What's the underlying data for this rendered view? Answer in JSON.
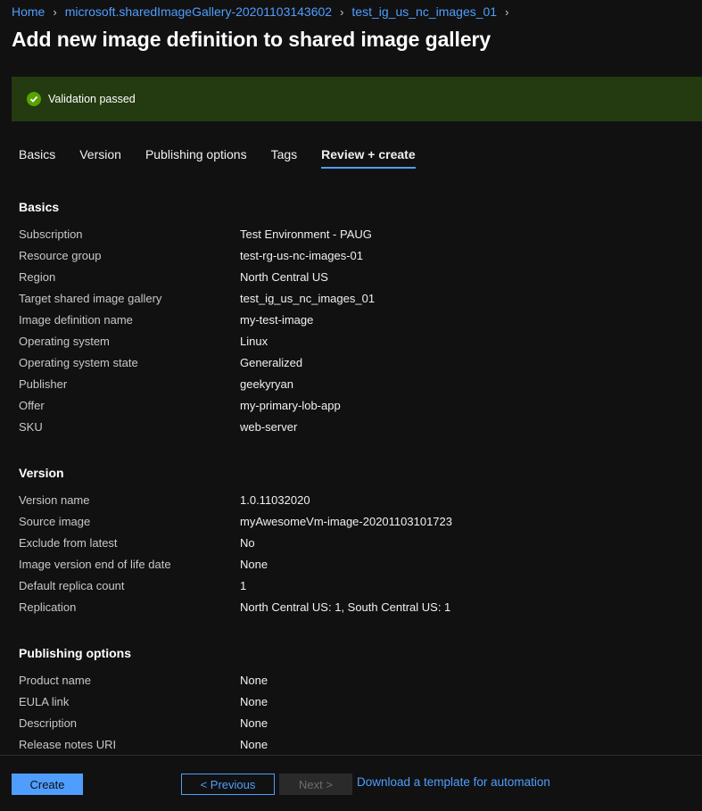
{
  "breadcrumb": [
    {
      "label": "Home"
    },
    {
      "label": "microsoft.sharedImageGallery-20201103143602"
    },
    {
      "label": "test_ig_us_nc_images_01"
    }
  ],
  "page_title": "Add new image definition to shared image gallery",
  "validation": {
    "text": "Validation passed",
    "color": "#57a300"
  },
  "tabs": [
    {
      "label": "Basics"
    },
    {
      "label": "Version"
    },
    {
      "label": "Publishing options"
    },
    {
      "label": "Tags"
    },
    {
      "label": "Review + create",
      "active": true
    }
  ],
  "sections": {
    "basics": {
      "title": "Basics",
      "rows": [
        {
          "label": "Subscription",
          "value": "Test Environment - PAUG"
        },
        {
          "label": "Resource group",
          "value": "test-rg-us-nc-images-01"
        },
        {
          "label": "Region",
          "value": "North Central US"
        },
        {
          "label": "Target shared image gallery",
          "value": "test_ig_us_nc_images_01"
        },
        {
          "label": "Image definition name",
          "value": "my-test-image"
        },
        {
          "label": "Operating system",
          "value": "Linux"
        },
        {
          "label": "Operating system state",
          "value": "Generalized"
        },
        {
          "label": "Publisher",
          "value": "geekyryan"
        },
        {
          "label": "Offer",
          "value": "my-primary-lob-app"
        },
        {
          "label": "SKU",
          "value": "web-server"
        }
      ]
    },
    "version": {
      "title": "Version",
      "rows": [
        {
          "label": "Version name",
          "value": "1.0.11032020"
        },
        {
          "label": "Source image",
          "value": "myAwesomeVm-image-20201103101723"
        },
        {
          "label": "Exclude from latest",
          "value": "No"
        },
        {
          "label": "Image version end of life date",
          "value": "None"
        },
        {
          "label": "Default replica count",
          "value": "1"
        },
        {
          "label": "Replication",
          "value": "North Central US: 1, South Central US: 1"
        }
      ]
    },
    "publishing": {
      "title": "Publishing options",
      "rows": [
        {
          "label": "Product name",
          "value": "None"
        },
        {
          "label": "EULA link",
          "value": "None"
        },
        {
          "label": "Description",
          "value": "None"
        },
        {
          "label": "Release notes URI",
          "value": "None"
        }
      ]
    }
  },
  "footer": {
    "create_label": "Create",
    "previous_label": "< Previous",
    "next_label": "Next >",
    "download_label": "Download a template for automation"
  },
  "colors": {
    "accent": "#4f9eff",
    "background": "#111111",
    "success_banner": "#243a10"
  }
}
